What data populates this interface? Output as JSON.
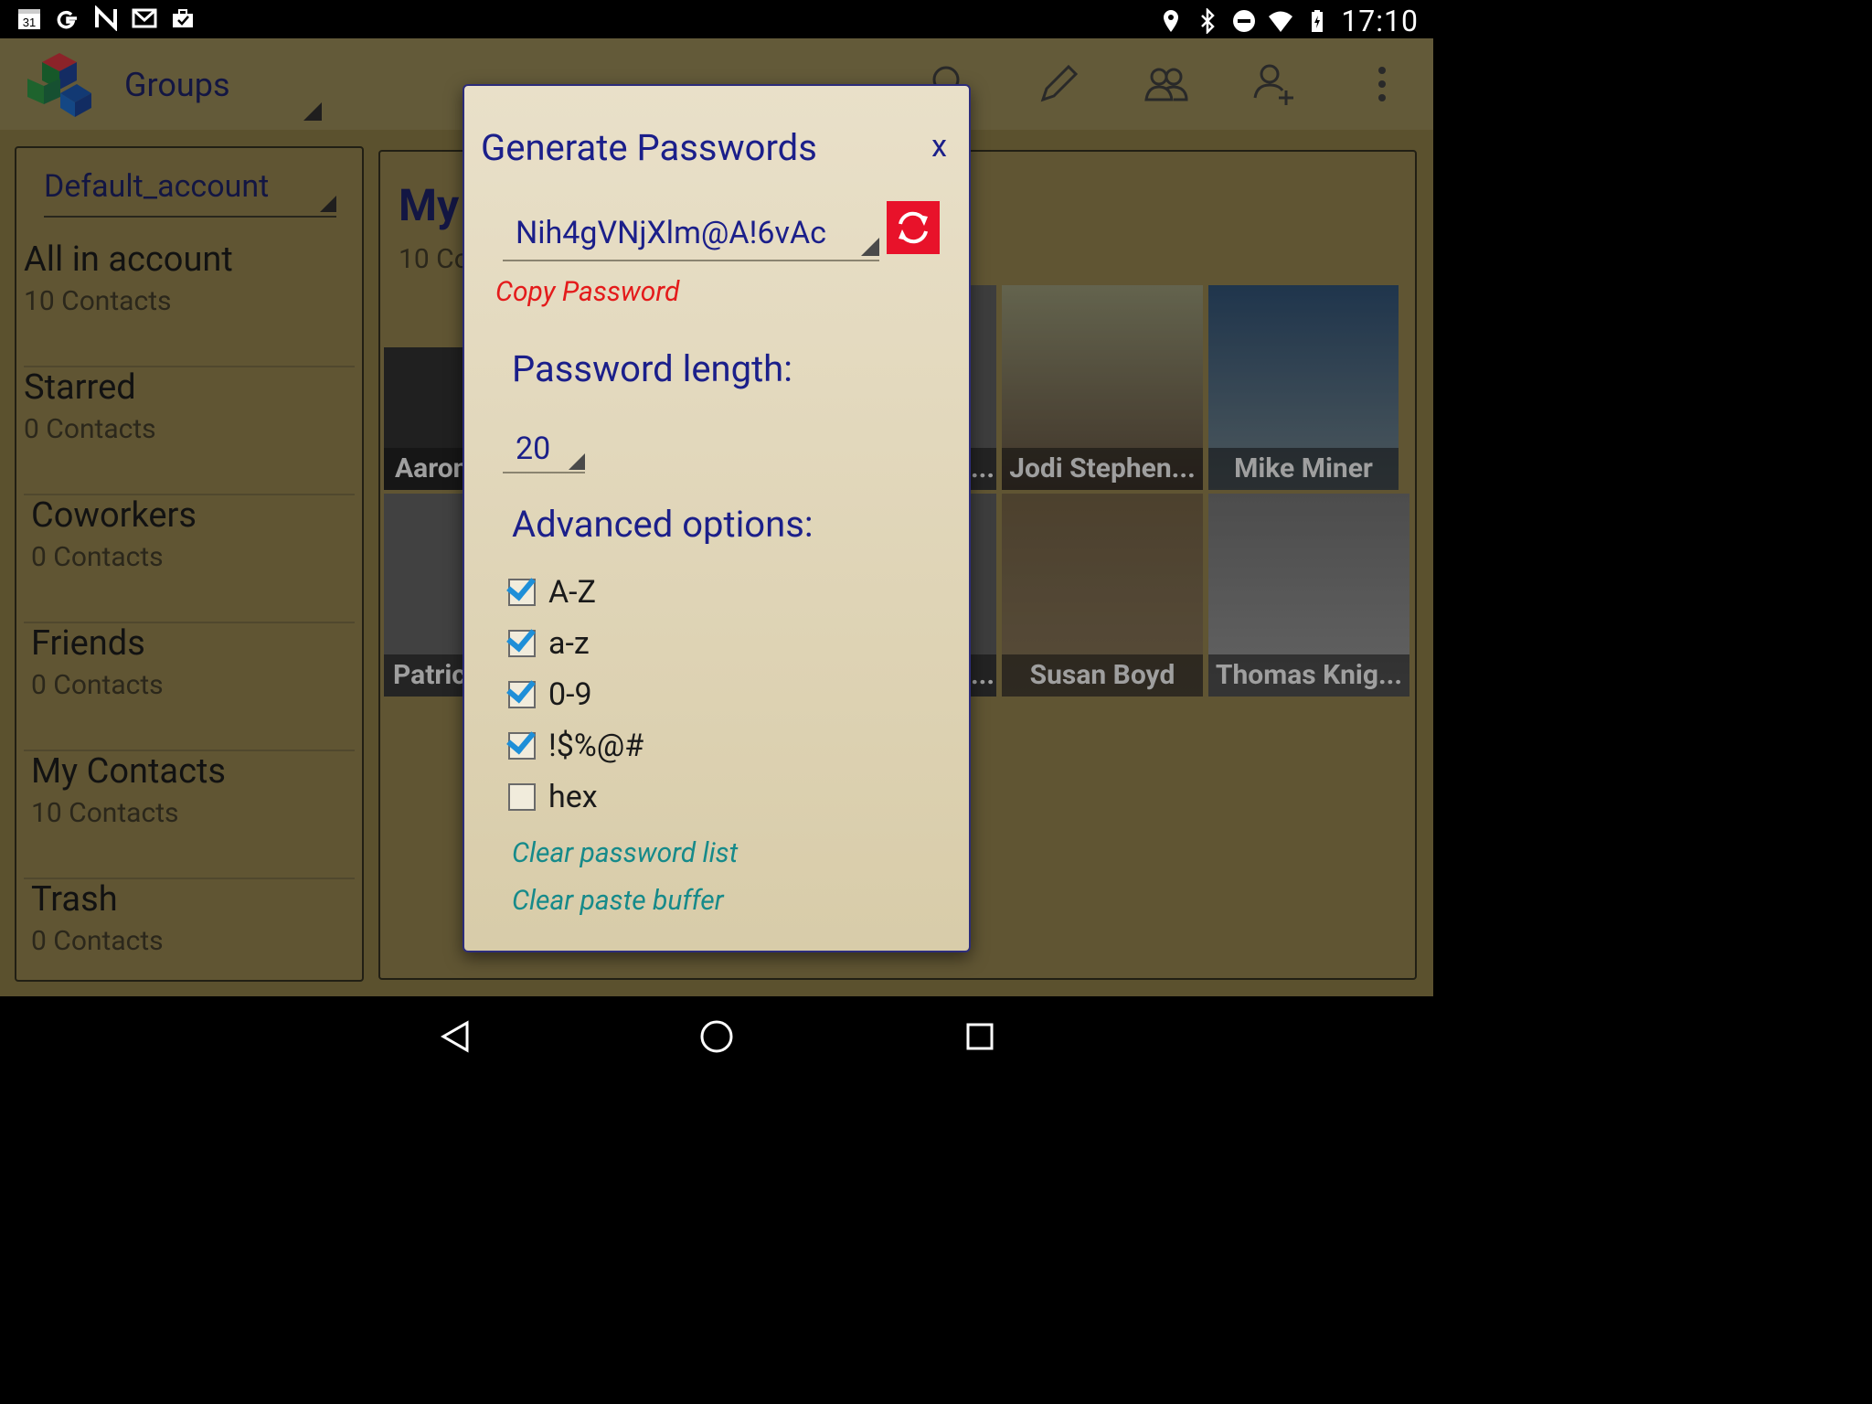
{
  "statusbar": {
    "time": "17:10",
    "left_icons": [
      "calendar-icon",
      "google-icon",
      "nfc-icon",
      "gmail-icon",
      "briefcase-icon"
    ],
    "calendar_day": "31",
    "right_icons": [
      "location-icon",
      "bluetooth-icon",
      "dnd-icon",
      "wifi-icon",
      "battery-icon"
    ]
  },
  "appbar": {
    "title": "Groups",
    "actions": [
      "search-icon",
      "edit-icon",
      "group-icon",
      "add-contact-icon",
      "overflow-menu-icon"
    ]
  },
  "left_panel": {
    "account": "Default_account",
    "groups": [
      {
        "name": "All in account",
        "count": "10 Contacts"
      },
      {
        "name": "Starred",
        "count": "0 Contacts"
      },
      {
        "name": "Coworkers",
        "count": "0 Contacts"
      },
      {
        "name": "Friends",
        "count": "0 Contacts"
      },
      {
        "name": "My Contacts",
        "count": "10 Contacts"
      },
      {
        "name": "Trash",
        "count": "0 Contacts"
      }
    ]
  },
  "right_panel": {
    "title_partial": "My",
    "subtitle_partial": "10 Co",
    "tiles": [
      {
        "label": "Aaron",
        "photo": "dark-gray"
      },
      {
        "label": "...",
        "photo": "gray"
      },
      {
        "label": "Jodi Stephen...",
        "photo": "warm"
      },
      {
        "label": "Mike Miner",
        "photo": "blue"
      },
      {
        "label": "Patric",
        "photo": "gray"
      },
      {
        "label": "...",
        "photo": "gray"
      },
      {
        "label": "Susan Boyd",
        "photo": "warm"
      },
      {
        "label": "Thomas Knig...",
        "photo": "light"
      }
    ]
  },
  "dialog": {
    "title": "Generate Passwords",
    "close_label": "x",
    "password_value": "Nih4gVNjXlm@A!6vAc",
    "copy_label": "Copy Password",
    "length_label": "Password length:",
    "length_value": "20",
    "advanced_label": "Advanced options:",
    "options": [
      {
        "label": "A-Z",
        "checked": true
      },
      {
        "label": "a-z",
        "checked": true
      },
      {
        "label": "0-9",
        "checked": true
      },
      {
        "label": "!$%@#",
        "checked": true
      },
      {
        "label": "hex",
        "checked": false
      }
    ],
    "clear_list_label": "Clear password list",
    "clear_buffer_label": "Clear paste buffer"
  },
  "navbar": {
    "buttons": [
      "back-icon",
      "home-icon",
      "recents-icon"
    ]
  },
  "colors": {
    "dialog_text": "#1b1f8a",
    "copy_link": "#e41b1b",
    "link": "#168a8a",
    "refresh_bg": "#e8122a",
    "checkbox": "#1e8fd8"
  }
}
